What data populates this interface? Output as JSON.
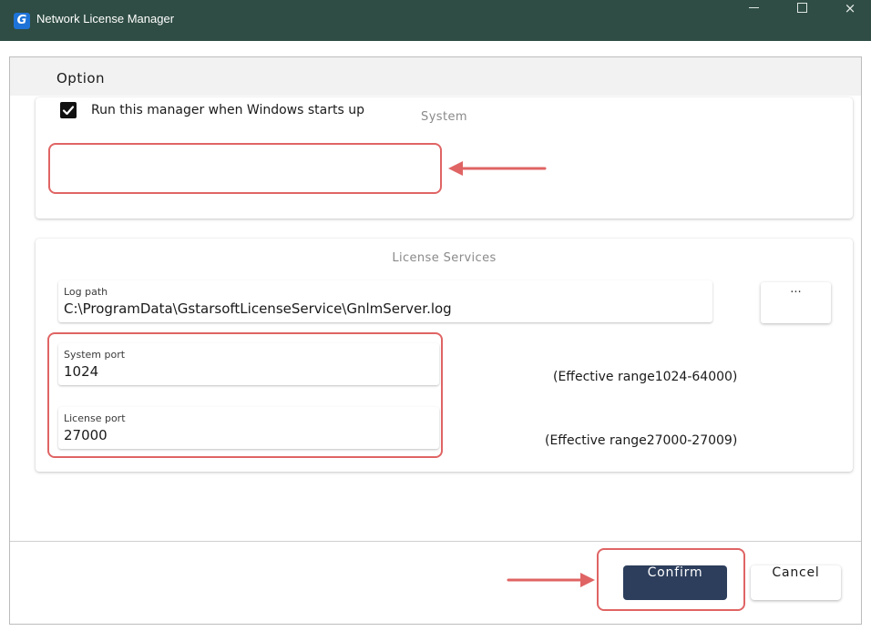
{
  "window": {
    "title": "Network License Manager",
    "icon_letter": "G",
    "controls": {
      "minimize": "minimize-icon",
      "maximize": "maximize-icon",
      "close": "×"
    }
  },
  "header": {
    "title": "Option"
  },
  "system": {
    "title": "System",
    "run_on_startup": {
      "label": "Run this manager when Windows starts up",
      "checked": true
    }
  },
  "license_services": {
    "title": "License Services",
    "log_path": {
      "label": "Log path",
      "value": "C:\\ProgramData\\GstarsoftLicenseService\\GnlmServer.log"
    },
    "browse_label": "...",
    "system_port": {
      "label": "System port",
      "value": "1024",
      "range": "(Effective range1024-64000)"
    },
    "license_port": {
      "label": "License port",
      "value": "27000",
      "range": "(Effective range27000-27009)"
    }
  },
  "footer": {
    "confirm_label": "Confirm",
    "cancel_label": "Cancel"
  },
  "colors": {
    "titlebar": "#2f4d44",
    "confirm": "#2c3e5c",
    "annotation": "#e06464"
  }
}
